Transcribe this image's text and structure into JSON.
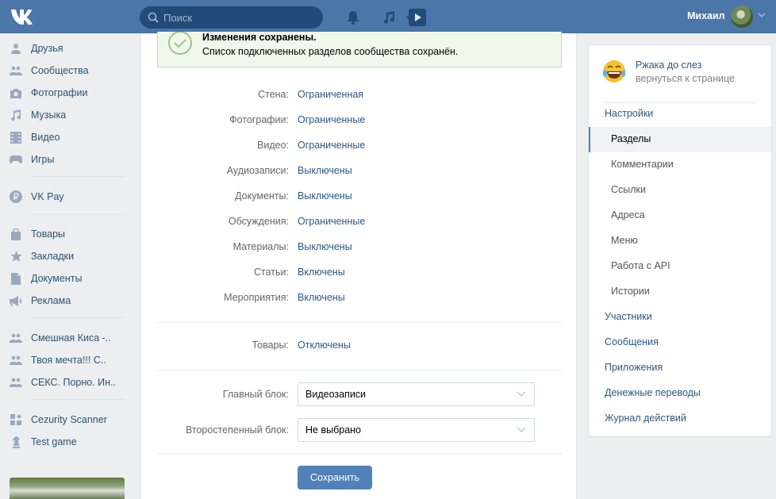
{
  "header": {
    "search_placeholder": "Поиск",
    "user_name": "Михаил",
    "icons": [
      "vk-logo-icon",
      "search-icon",
      "bell-icon",
      "music-note-icon",
      "video-play-icon",
      "chevron-down-icon"
    ],
    "accent_color": "#4a76a8"
  },
  "leftnav": {
    "items": [
      {
        "label": "Друзья",
        "icon": "friend-icon"
      },
      {
        "label": "Сообщества",
        "icon": "groups-icon"
      },
      {
        "label": "Фотографии",
        "icon": "camera-icon"
      },
      {
        "label": "Музыка",
        "icon": "music-note-icon"
      },
      {
        "label": "Видео",
        "icon": "film-icon"
      },
      {
        "label": "Игры",
        "icon": "gamepad-icon"
      },
      {
        "label": "VK Pay",
        "icon": "ruble-coin-icon"
      },
      {
        "label": "Товары",
        "icon": "shopping-bag-icon"
      },
      {
        "label": "Закладки",
        "icon": "star-icon"
      },
      {
        "label": "Документы",
        "icon": "document-icon"
      },
      {
        "label": "Реклама",
        "icon": "megaphone-icon"
      },
      {
        "label": "Смешная Киса -..",
        "icon": "groups-icon"
      },
      {
        "label": "Твоя мечта!!! С..",
        "icon": "groups-icon"
      },
      {
        "label": "СЕКС. Порно. Ин..",
        "icon": "groups-icon"
      },
      {
        "label": "Cezurity Scanner",
        "icon": "apps-icon"
      },
      {
        "label": "Test game",
        "icon": "chess-knight-icon"
      }
    ]
  },
  "notice": {
    "title": "Изменения сохранены.",
    "text": "Список подключенных разделов сообщества сохранён."
  },
  "sections": [
    {
      "label": "Стена:",
      "value": "Ограниченная"
    },
    {
      "label": "Фотографии:",
      "value": "Ограниченные"
    },
    {
      "label": "Видео:",
      "value": "Ограниченные"
    },
    {
      "label": "Аудиозаписи:",
      "value": "Выключены"
    },
    {
      "label": "Документы:",
      "value": "Выключены"
    },
    {
      "label": "Обсуждения:",
      "value": "Ограниченные"
    },
    {
      "label": "Материалы:",
      "value": "Выключены"
    },
    {
      "label": "Статьи:",
      "value": "Включены"
    },
    {
      "label": "Мероприятия:",
      "value": "Включены"
    }
  ],
  "goods": {
    "label": "Товары:",
    "value": "Отключены"
  },
  "blocks": {
    "main_label": "Главный блок:",
    "main_value": "Видеозаписи",
    "secondary_label": "Второстепенный блок:",
    "secondary_value": "Не выбрано"
  },
  "save_label": "Сохранить",
  "rpanel": {
    "group_name": "Ржака до слез",
    "back_link": "вернуться к странице",
    "menu": [
      {
        "label": "Настройки",
        "type": "top"
      },
      {
        "label": "Разделы",
        "type": "sub",
        "active": true
      },
      {
        "label": "Комментарии",
        "type": "sub"
      },
      {
        "label": "Ссылки",
        "type": "sub"
      },
      {
        "label": "Адреса",
        "type": "sub"
      },
      {
        "label": "Меню",
        "type": "sub"
      },
      {
        "label": "Работа с API",
        "type": "sub"
      },
      {
        "label": "Истории",
        "type": "sub"
      },
      {
        "label": "Участники",
        "type": "top"
      },
      {
        "label": "Сообщения",
        "type": "top"
      },
      {
        "label": "Приложения",
        "type": "top"
      },
      {
        "label": "Денежные переводы",
        "type": "top"
      },
      {
        "label": "Журнал действий",
        "type": "top"
      }
    ]
  }
}
